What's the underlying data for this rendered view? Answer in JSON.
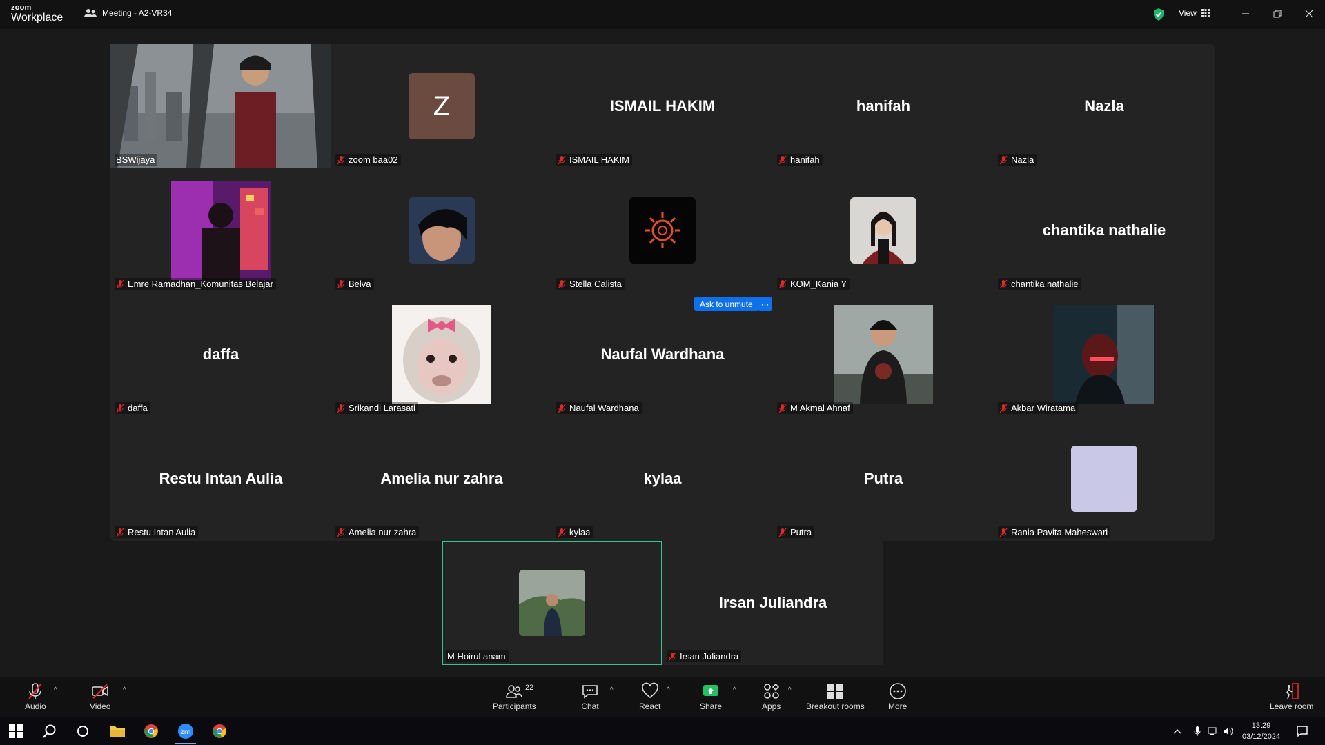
{
  "app": {
    "logo_line1": "zoom",
    "logo_line2": "Workplace",
    "meeting_title": "Meeting - A2-VR34",
    "view_label": "View"
  },
  "tiles": [
    {
      "name": "BSWijaya",
      "display": "",
      "avatar": "video-bswijaya"
    },
    {
      "name": "zoom baa02",
      "display": "",
      "avatar": "letter-z",
      "letter": "Z"
    },
    {
      "name": "ISMAIL HAKIM",
      "display": "ISMAIL HAKIM"
    },
    {
      "name": "hanifah",
      "display": "hanifah"
    },
    {
      "name": "Nazla",
      "display": "Nazla"
    },
    {
      "name": "Emre Ramadhan_Komunitas Belajar",
      "display": "",
      "avatar": "photo-emre"
    },
    {
      "name": "Belva",
      "display": "",
      "avatar": "photo-belva"
    },
    {
      "name": "Stella Calista",
      "display": "",
      "avatar": "photo-stella"
    },
    {
      "name": "KOM_Kania Y",
      "display": "",
      "avatar": "photo-kania"
    },
    {
      "name": "chantika nathalie",
      "display": "chantika nathalie"
    },
    {
      "name": "daffa",
      "display": "daffa"
    },
    {
      "name": "Srikandi Larasati",
      "display": "",
      "avatar": "photo-srikandi"
    },
    {
      "name": "Naufal Wardhana",
      "display": "Naufal Wardhana"
    },
    {
      "name": "M Akmal Ahnaf",
      "display": "",
      "avatar": "photo-akmal"
    },
    {
      "name": "Akbar Wiratama",
      "display": "",
      "avatar": "photo-akbar"
    },
    {
      "name": "Restu Intan Aulia",
      "display": "Restu Intan Aulia"
    },
    {
      "name": "Amelia nur zahra",
      "display": "Amelia nur zahra"
    },
    {
      "name": "kylaa",
      "display": "kylaa"
    },
    {
      "name": "Putra",
      "display": "Putra"
    },
    {
      "name": "Rania Pavita Maheswari",
      "display": "",
      "avatar": "blank-rania"
    },
    {
      "name": "M Hoirul anam",
      "display": "",
      "avatar": "photo-hoirul"
    },
    {
      "name": "Irsan Juliandra",
      "display": "Irsan Juliandra"
    }
  ],
  "ask_unmute": {
    "label": "Ask to unmute",
    "more": "···"
  },
  "toolbar": {
    "audio": "Audio",
    "video": "Video",
    "participants": "Participants",
    "participants_count": "22",
    "chat": "Chat",
    "react": "React",
    "share": "Share",
    "apps": "Apps",
    "breakout": "Breakout rooms",
    "more": "More",
    "leave": "Leave room"
  },
  "taskbar": {
    "time": "13:29",
    "date": "03/12/2024"
  },
  "colors": {
    "accent_blue": "#0e71eb",
    "active_green": "#2ec88f",
    "muted_red": "#e02828",
    "share_green": "#24c162"
  }
}
